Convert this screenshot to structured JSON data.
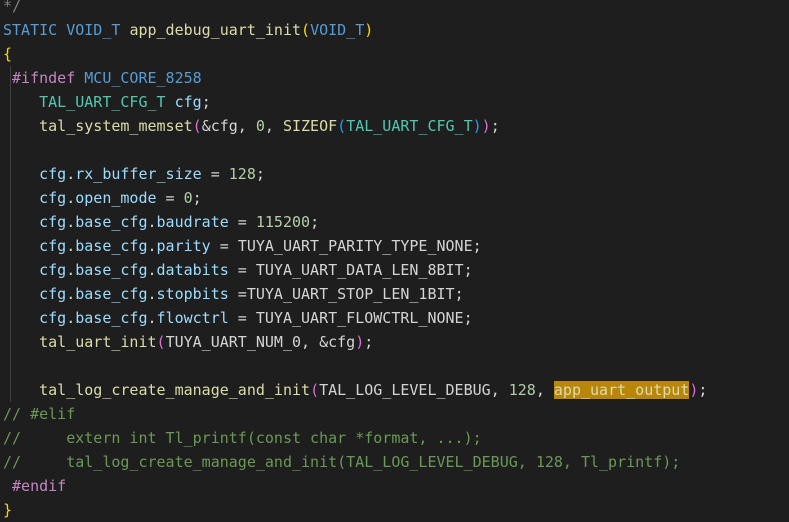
{
  "editor": {
    "lines": {
      "top_fragment": "*/",
      "signature": {
        "ret_kw": "STATIC",
        "ret_type": "VOID_T",
        "name": "app_debug_uart_init",
        "open": "(",
        "param": "VOID_T",
        "close": ")"
      },
      "open_brace": "{",
      "ifndef": {
        "directive": "#ifndef",
        "macro": "MCU_CORE_8258"
      },
      "decl": {
        "type": "TAL_UART_CFG_T",
        "var": "cfg",
        "end": ";"
      },
      "memset": {
        "fn": "tal_system_memset",
        "open": "(",
        "args1": "&cfg, ",
        "zero": "0",
        "sep": ", ",
        "sizeof": "SIZEOF",
        "open2": "(",
        "type": "TAL_UART_CFG_T",
        "close2": ")",
        "close": ")",
        "end": ";"
      },
      "rx_buffer": {
        "obj": "cfg",
        "field": "rx_buffer_size",
        "op": " = ",
        "val": "128",
        "end": ";"
      },
      "open_mode": {
        "obj": "cfg",
        "field": "open_mode",
        "op": " = ",
        "val": "0",
        "end": ";"
      },
      "baudrate": {
        "obj": "cfg",
        "mid": "base_cfg",
        "field": "baudrate",
        "op": " = ",
        "val": "115200",
        "end": ";"
      },
      "parity": {
        "obj": "cfg",
        "mid": "base_cfg",
        "field": "parity",
        "op": " = ",
        "val": "TUYA_UART_PARITY_TYPE_NONE",
        "end": ";"
      },
      "databits": {
        "obj": "cfg",
        "mid": "base_cfg",
        "field": "databits",
        "op": " = ",
        "val": "TUYA_UART_DATA_LEN_8BIT",
        "end": ";"
      },
      "stopbits": {
        "obj": "cfg",
        "mid": "base_cfg",
        "field": "stopbits",
        "op": " =",
        "val": "TUYA_UART_STOP_LEN_1BIT",
        "end": ";"
      },
      "flowctrl": {
        "obj": "cfg",
        "mid": "base_cfg",
        "field": "flowctrl",
        "op": " = ",
        "val": "TUYA_UART_FLOWCTRL_NONE",
        "end": ";"
      },
      "uart_init": {
        "fn": "tal_uart_init",
        "open": "(",
        "arg1": "TUYA_UART_NUM_0",
        "rest": ", &cfg",
        "close": ")",
        "end": ";"
      },
      "log_create": {
        "fn": "tal_log_create_manage_and_init",
        "open": "(",
        "arg1": "TAL_LOG_LEVEL_DEBUG",
        "sep": ", ",
        "num": "128",
        "sep2": ", ",
        "highlight": "app_uart_output",
        "close": ")",
        "end": ";"
      },
      "comment1": "// #elif",
      "comment2": "//     extern int Tl_printf(const char *format, ...);",
      "comment3": "//     tal_log_create_manage_and_init(TAL_LOG_LEVEL_DEBUG, 128, Tl_printf);",
      "endif": "#endif",
      "close_brace": "}"
    },
    "colors": {
      "background": "#1e1e1e",
      "keyword": "#569cd6",
      "function": "#dcdcaa",
      "type": "#4ec9b0",
      "variable": "#9cdcfe",
      "number": "#b5cea8",
      "preprocessor": "#c586c0",
      "comment": "#6a9955",
      "highlight": "#b8860b"
    }
  }
}
